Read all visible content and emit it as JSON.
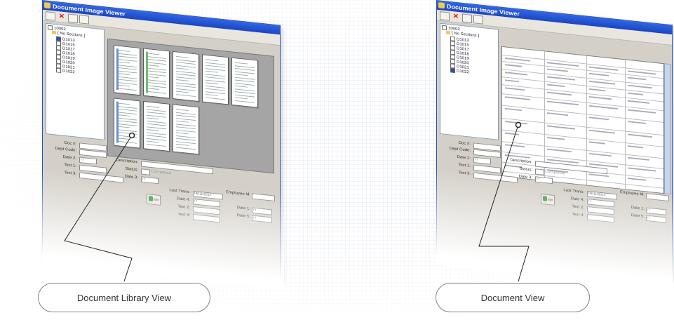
{
  "callouts": {
    "left": "Document Library View",
    "right": "Document View"
  },
  "window": {
    "title": "Document Image Viewer",
    "tree_root": "10002",
    "tree_group": "[ No Sections ]",
    "left_docs": [
      "D1013",
      "D1015",
      "D1017",
      "D1018",
      "D1019",
      "D1020",
      "D1021",
      "D1022"
    ],
    "right_docs": [
      "D1013",
      "D1015",
      "D1017",
      "D1018",
      "D1019",
      "D1020",
      "D1021",
      "D1022"
    ],
    "labels": {
      "doc_no": "Doc #:",
      "dept_code": "Dept Code:",
      "date2": "Date 2:",
      "text1": "Text 1:",
      "text3": "Text 3:",
      "description": "Description:",
      "status": "Status:",
      "completed": "Completed",
      "date3": "Date 3:",
      "last_trans": "Last Trans:",
      "employee_id": "Employee Id:",
      "date4": "Date 4:",
      "text2": "Text 2:",
      "text4": "Text 4:",
      "date1": "Date 1:",
      "date5": "Date 5:",
      "edit": "Edit"
    },
    "date_placeholder": "/ /",
    "last_trans_value": "05/11/2012",
    "colors": {
      "title_bar": "#2f66e6",
      "frame": "#2a4fb4",
      "viewer_bg": "#a5a5a5",
      "panel": "#d4d0c8"
    }
  }
}
